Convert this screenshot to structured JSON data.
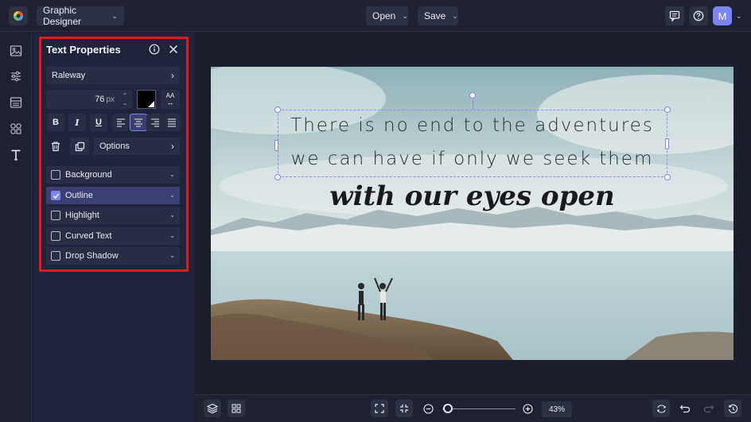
{
  "app": {
    "mode_label": "Graphic Designer",
    "open_label": "Open",
    "save_label": "Save",
    "avatar_initial": "M"
  },
  "panel": {
    "title": "Text Properties",
    "font_name": "Raleway",
    "font_size": "76",
    "font_size_unit": "px",
    "text_color": "#000000",
    "case_button_label": "AA",
    "format_buttons": [
      "B",
      "I",
      "U"
    ],
    "align_active": "center",
    "options_label": "Options",
    "sections": [
      {
        "label": "Background",
        "checked": false
      },
      {
        "label": "Outline",
        "checked": true
      },
      {
        "label": "Highlight",
        "checked": false
      },
      {
        "label": "Curved Text",
        "checked": false
      },
      {
        "label": "Drop Shadow",
        "checked": false
      }
    ]
  },
  "canvas": {
    "quote_line1": "There is no end to the adventures",
    "quote_line2": "we can have if only we seek them",
    "script_line": "with our eyes open"
  },
  "zoom": {
    "value": "43%",
    "level": 0.08
  },
  "colors": {
    "accent": "#7b84f5",
    "highlight_border": "#e01919",
    "panel_bg": "#20243a",
    "app_bg": "#1b1e2b"
  }
}
